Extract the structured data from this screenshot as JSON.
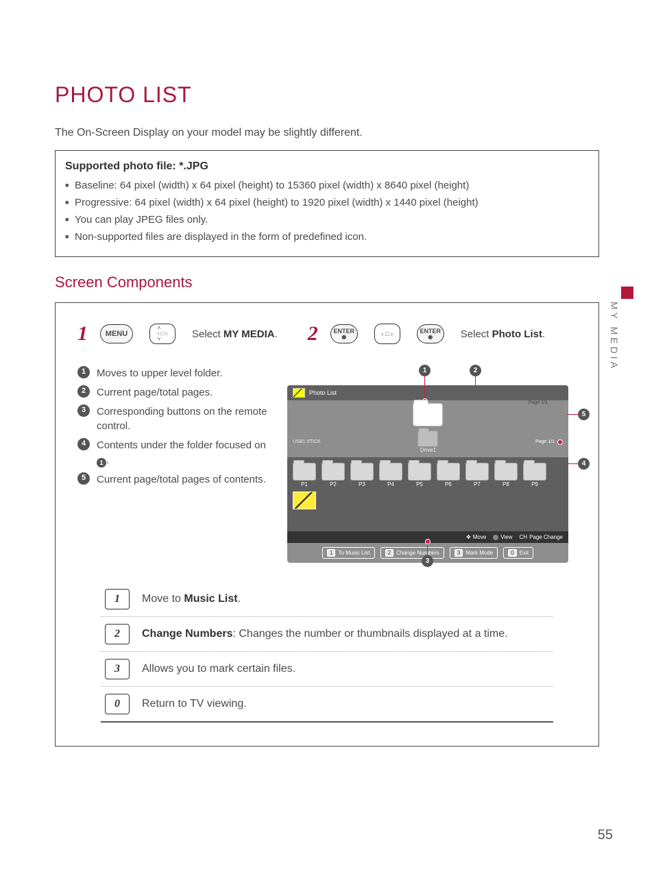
{
  "title": "PHOTO LIST",
  "intro": "The On-Screen Display on your model may be slightly different.",
  "info_title": "Supported photo file: *.JPG",
  "info_items": [
    "Baseline: 64 pixel (width) x 64 pixel (height) to 15360 pixel (width) x 8640 pixel (height)",
    "Progressive: 64 pixel (width) x 64 pixel (height) to 1920 pixel (width) x 1440 pixel (height)",
    "You can play JPEG files only.",
    "Non-supported files are displayed in the form of predefined icon."
  ],
  "subtitle": "Screen Components",
  "side_tab": "MY MEDIA",
  "page_number": "55",
  "steps": {
    "s1": {
      "num": "1",
      "btn_menu": "MENU",
      "text_pre": "Select ",
      "text_bold": "MY MEDIA",
      "text_post": "."
    },
    "s2": {
      "num": "2",
      "btn_enter": "ENTER",
      "text_pre": "Select ",
      "text_bold": "Photo List",
      "text_post": "."
    }
  },
  "legend": [
    {
      "n": "1",
      "t": "Moves to upper level folder."
    },
    {
      "n": "2",
      "t": "Current page/total pages."
    },
    {
      "n": "3",
      "t": "Corresponding buttons on the remote control."
    },
    {
      "n": "4",
      "t_pre": "Contents under the folder focused on ",
      "icon": "1",
      "t_post": "."
    },
    {
      "n": "5",
      "t": "Current page/total pages of contents."
    }
  ],
  "osd": {
    "header": "Photo List",
    "page_top": "Page 1/1",
    "usb": "USB1 XTICK",
    "drive": "Drive1",
    "page_right": "Page 1/1",
    "thumbs": [
      "P1",
      "P2",
      "P3",
      "P4",
      "P5",
      "P6",
      "P7",
      "P8",
      "P9"
    ],
    "hints": {
      "move": "Move",
      "view": "View",
      "page": "Page Change"
    },
    "cmds": [
      {
        "key": "1",
        "label": "To Music List"
      },
      {
        "key": "2",
        "label": "Change Numbers"
      },
      {
        "key": "3",
        "label": "Mark Mode"
      },
      {
        "key": "0",
        "label": "Exit"
      }
    ]
  },
  "callouts": {
    "c1": "1",
    "c2": "2",
    "c3": "3",
    "c4": "4",
    "c5": "5"
  },
  "bottom": [
    {
      "key": "1",
      "pre": "Move to ",
      "bold": "Music List",
      "post": "."
    },
    {
      "key": "2",
      "bold": "Change Numbers",
      "post": ": Changes the number or thumbnails displayed at a time."
    },
    {
      "key": "3",
      "pre": "Allows you to mark certain files."
    },
    {
      "key": "0",
      "pre": "Return to TV viewing."
    }
  ]
}
